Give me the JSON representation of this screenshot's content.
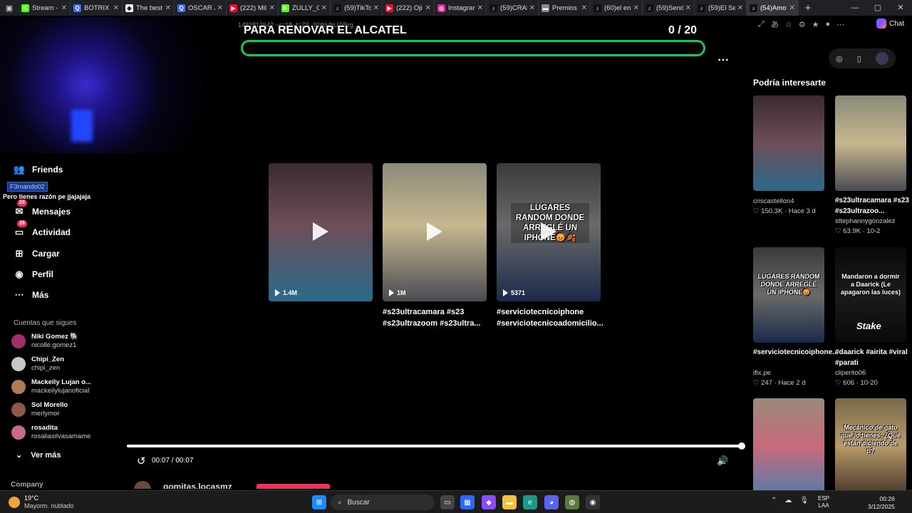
{
  "browser": {
    "tabs": [
      {
        "title": "Stream -",
        "color": "#53fc18",
        "glyph": "K"
      },
      {
        "title": "BOTRIX -",
        "color": "#3b6cff",
        "glyph": "Q"
      },
      {
        "title": "The best",
        "color": "#ffffff",
        "glyph": "◆"
      },
      {
        "title": "OSCAR JI",
        "color": "#3b6cff",
        "glyph": "Q"
      },
      {
        "title": "(222) Mil",
        "color": "#ff0033",
        "glyph": "▶"
      },
      {
        "title": "ZULLY_C",
        "color": "#53fc18",
        "glyph": "K"
      },
      {
        "title": "(59)TikTo",
        "color": "#111111",
        "glyph": "♪"
      },
      {
        "title": "(222) Oji",
        "color": "#ff0033",
        "glyph": "▶"
      },
      {
        "title": "Instagran",
        "color": "#d6249f",
        "glyph": "◎"
      },
      {
        "title": "(59)CRAF",
        "color": "#111111",
        "glyph": "♪"
      },
      {
        "title": "Premios I",
        "color": "#888888",
        "glyph": "▬"
      },
      {
        "title": "(60)el en",
        "color": "#111111",
        "glyph": "♪"
      },
      {
        "title": "(59)Send",
        "color": "#111111",
        "glyph": "♪"
      },
      {
        "title": "(59)El Se",
        "color": "#111111",
        "glyph": "♪"
      },
      {
        "title": "(54)Amo",
        "color": "#111111",
        "glyph": "♪",
        "active": true
      }
    ],
    "url_fragment": "1482812642 ~r=18~t=ZS_91tbVbU7iBrg...",
    "chat_label": "Chat"
  },
  "overlay": {
    "goal_title": "PARA RENOVAR EL ALCATEL",
    "goal_count": "0  / 20",
    "goal_color": "#21c05a",
    "chat_user": "F3rnando02",
    "chat_message": "Pero tienes razón pe jjajajaja"
  },
  "sidebar": {
    "items": [
      {
        "label": "Friends",
        "icon": "friends-icon"
      },
      {
        "label": "Mensajes",
        "icon": "messages-icon",
        "badge": "28"
      },
      {
        "label": "Actividad",
        "icon": "activity-icon",
        "badge": "26"
      },
      {
        "label": "Cargar",
        "icon": "upload-icon"
      },
      {
        "label": "Perfil",
        "icon": "profile-icon"
      },
      {
        "label": "Más",
        "icon": "more-icon"
      }
    ],
    "following_header": "Cuentas que sigues",
    "following": [
      {
        "name": "Niki Gomez 🐘",
        "handle": "nicolle.gomez1",
        "color": "#a0306a"
      },
      {
        "name": "Chipi_Zen",
        "handle": "chipi_zen",
        "color": "#c8c8c8"
      },
      {
        "name": "Mackeily Lujan o...",
        "handle": "mackeilylujanoficial",
        "color": "#b07a5a"
      },
      {
        "name": "Sol Morello",
        "handle": "merlymor",
        "color": "#8a5a4a"
      },
      {
        "name": "rosadita",
        "handle": "rosaliasilvasamame",
        "color": "#c86a8a"
      }
    ],
    "see_more": "Ver más",
    "company": "Company"
  },
  "videos": [
    {
      "views": "1.4M",
      "caption": "",
      "colors": [
        "#3b2a2e",
        "#6e4e5a",
        "#2a6a8a"
      ]
    },
    {
      "views": "1M",
      "caption": "#s23ultracamara #s23 #s23ultrazoom #s23ultra...",
      "colors": [
        "#8a8a7a",
        "#c8b890",
        "#4a4a52"
      ]
    },
    {
      "views": "5371",
      "caption": "#serviciotecnicoiphone #serviciotecnicoadomicilio...",
      "colors": [
        "#3a3a3a",
        "#6a6a6a",
        "#1a2a4a"
      ],
      "overlay": "LUGARES RANDOM DONDE ARREGLÉ UN IPHONE😡🍂"
    }
  ],
  "player": {
    "time": "00:07 / 00:07",
    "progress": 1.0,
    "author": "gomitas.locasmz"
  },
  "right_panel": {
    "title": "Podría interesarte",
    "cards": [
      {
        "author": "criscastellon4",
        "caption": "",
        "likes": "150.3K",
        "when": "Hace 3 d",
        "colors": [
          "#3b2a2e",
          "#6e4e5a",
          "#2a6a8a"
        ]
      },
      {
        "author": "sttephannygonzalez",
        "caption": "#s23ultracamara #s23 #s23ultrazoo...",
        "likes": "63.9K",
        "when": "10-2",
        "colors": [
          "#8a8a7a",
          "#c8b890",
          "#4a4a52"
        ]
      },
      {
        "author": "ifix.pe",
        "caption": "#serviciotecnicoiphone...",
        "likes": "247",
        "when": "Hace 2 d",
        "colors": [
          "#3a3a3a",
          "#6a6a6a",
          "#1a2a4a"
        ],
        "overlay": "LUGARES RANDOM DONDE ARREGLÉ UN IPHONE😡"
      },
      {
        "author": "cliperito06",
        "caption": "#daarick #airita #viral #parati",
        "likes": "606",
        "when": "10-20",
        "colors": [
          "#0a0a0a",
          "#1a1a1a",
          "#0a0a0a"
        ],
        "overlay": "Mandaron a dormir a Daarick (Le apagaron las luces)",
        "brand": "Stake"
      },
      {
        "author": "",
        "caption": "",
        "likes": "",
        "when": "",
        "colors": [
          "#9a8a7a",
          "#c86a7a",
          "#5a7aaa"
        ]
      },
      {
        "author": "",
        "caption": "",
        "likes": "",
        "when": "",
        "colors": [
          "#7a6a4a",
          "#b89a6a",
          "#4a3a2a"
        ],
        "overlay": "Mecánico de gato que lo tienes: ¿Qué están diciendo de ti?"
      }
    ]
  },
  "taskbar": {
    "temp": "19°C",
    "weather": "Mayorm. nublado",
    "search": "Buscar",
    "lang1": "ESP",
    "lang2": "LAA",
    "time": "00:26",
    "date": "3/12/2025"
  }
}
